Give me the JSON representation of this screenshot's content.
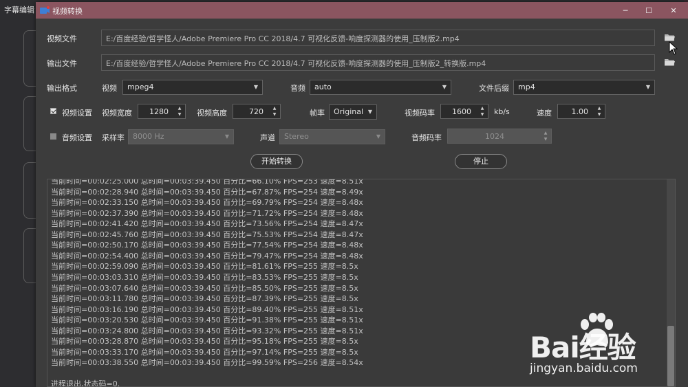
{
  "background_window": {
    "title": "字幕编辑"
  },
  "dialog": {
    "title": "视频转换",
    "titlebar_color": "#8b5560",
    "controls": {
      "minimize": "─",
      "maximize": "☐",
      "close": "✕"
    }
  },
  "files": {
    "input_label": "视频文件",
    "input_path": "E:/百度经验/哲学怪人/Adobe Premiere Pro CC 2018/4.7 可视化反馈-响度探测器的使用_压制版2.mp4",
    "output_label": "输出文件",
    "output_path": "E:/百度经验/哲学怪人/Adobe Premiere Pro CC 2018/4.7 可视化反馈-响度探测器的使用_压制版2_转换版.mp4"
  },
  "format": {
    "label": "输出格式",
    "video_label": "视频",
    "video_value": "mpeg4",
    "audio_label": "音频",
    "audio_value": "auto",
    "ext_label": "文件后缀",
    "ext_value": "mp4"
  },
  "video_settings": {
    "label": "视频设置",
    "checked": true,
    "width_label": "视频宽度",
    "width": "1280",
    "height_label": "视频高度",
    "height": "720",
    "fps_label": "帧率",
    "fps": "Original",
    "bitrate_label": "视频码率",
    "bitrate": "1600",
    "bitrate_unit": "kb/s",
    "speed_label": "速度",
    "speed": "1.00"
  },
  "audio_settings": {
    "label": "音频设置",
    "checked": false,
    "samplerate_label": "采样率",
    "samplerate": "8000 Hz",
    "channel_label": "声道",
    "channel": "Stereo",
    "bitrate_label": "音频码率",
    "bitrate": "1024"
  },
  "actions": {
    "start": "开始转换",
    "stop": "停止"
  },
  "log": {
    "lines": [
      "当前时间=00:02:25.000 总时间=00:03:39.450 百分比=66.10% FPS=253 速度=8.51x",
      "当前时间=00:02:28.940 总时间=00:03:39.450 百分比=67.87% FPS=254 速度=8.49x",
      "当前时间=00:02:33.150 总时间=00:03:39.450 百分比=69.79% FPS=254 速度=8.48x",
      "当前时间=00:02:37.390 总时间=00:03:39.450 百分比=71.72% FPS=254 速度=8.48x",
      "当前时间=00:02:41.420 总时间=00:03:39.450 百分比=73.56% FPS=254 速度=8.47x",
      "当前时间=00:02:45.760 总时间=00:03:39.450 百分比=75.53% FPS=254 速度=8.47x",
      "当前时间=00:02:50.170 总时间=00:03:39.450 百分比=77.54% FPS=254 速度=8.48x",
      "当前时间=00:02:54.400 总时间=00:03:39.450 百分比=79.47% FPS=254 速度=8.48x",
      "当前时间=00:02:59.090 总时间=00:03:39.450 百分比=81.61% FPS=255 速度=8.5x",
      "当前时间=00:03:03.310 总时间=00:03:39.450 百分比=83.53% FPS=255 速度=8.5x",
      "当前时间=00:03:07.640 总时间=00:03:39.450 百分比=85.50% FPS=255 速度=8.5x",
      "当前时间=00:03:11.780 总时间=00:03:39.450 百分比=87.39% FPS=255 速度=8.5x",
      "当前时间=00:03:16.190 总时间=00:03:39.450 百分比=89.40% FPS=255 速度=8.51x",
      "当前时间=00:03:20.530 总时间=00:03:39.450 百分比=91.38% FPS=255 速度=8.51x",
      "当前时间=00:03:24.800 总时间=00:03:39.450 百分比=93.32% FPS=255 速度=8.51x",
      "当前时间=00:03:28.870 总时间=00:03:39.450 百分比=95.18% FPS=255 速度=8.5x",
      "当前时间=00:03:33.170 总时间=00:03:39.450 百分比=97.14% FPS=255 速度=8.5x",
      "当前时间=00:03:38.550 总时间=00:03:39.450 百分比=99.59% FPS=256 速度=8.54x",
      "",
      "进程退出,状态码=0."
    ]
  },
  "watermark": {
    "brand": "Bai经验",
    "url": "jingyan.baidu.com"
  }
}
